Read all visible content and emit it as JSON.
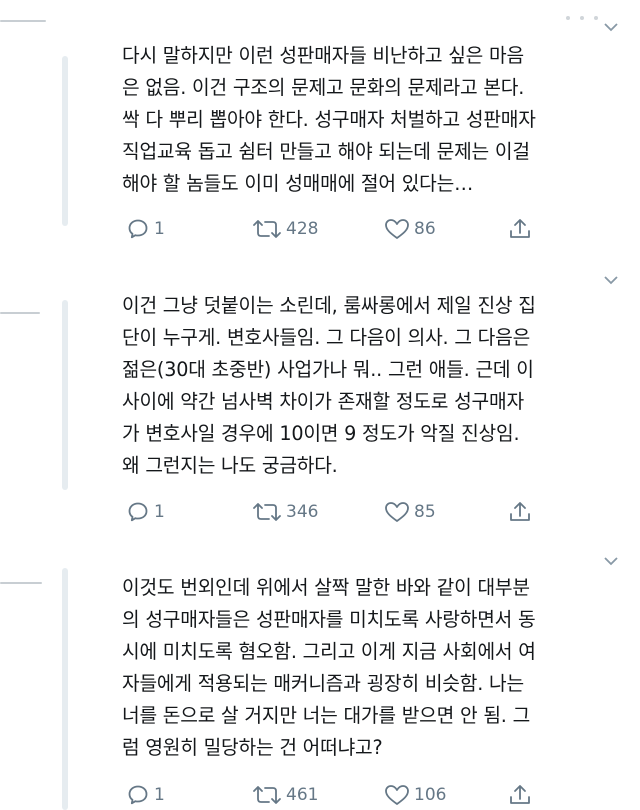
{
  "tweets": [
    {
      "text": "다시 말하지만 이런 성판매자들 비난하고 싶은 마음\n은 없음. 이건 구조의 문제고 문화의 문제라고 본다.\n싹 다 뿌리 뽑아야 한다. 성구매자 처벌하고 성판매자\n직업교육 돕고 쉼터 만들고 해야 되는데 문제는 이걸\n해야 할 놈들도 이미 성매매에 절어 있다는…",
      "replies": "1",
      "retweets": "428",
      "likes": "86"
    },
    {
      "text": "이건 그냥 덧붙이는 소린데, 룸싸롱에서 제일 진상 집\n단이 누구게. 변호사들임. 그 다음이 의사. 그 다음은\n젊은(30대 초중반) 사업가나 뭐.. 그런 애들. 근데 이\n사이에 약간 넘사벽 차이가 존재할 정도로 성구매자\n가 변호사일 경우에 10이면 9 정도가 악질 진상임.\n왜 그런지는 나도 궁금하다.",
      "replies": "1",
      "retweets": "346",
      "likes": "85"
    },
    {
      "text": "이것도 번외인데 위에서 살짝 말한 바와 같이 대부분\n의 성구매자들은 성판매자를 미치도록 사랑하면서 동\n시에 미치도록 혐오함. 그리고 이게 지금 사회에서 여\n자들에게 적용되는 매커니즘과 굉장히 비슷함. 나는\n너를 돈으로 살 거지만 너는 대가를 받으면 안 됨. 그\n럼 영원히 밀당하는 건 어떠냐고?",
      "replies": "1",
      "retweets": "461",
      "likes": "106"
    }
  ],
  "icons": {
    "reply": "reply-icon",
    "retweet": "retweet-icon",
    "like": "heart-icon",
    "share": "share-icon",
    "more": "chevron-down-icon"
  },
  "colors": {
    "text": "#14171a",
    "icon": "#657786",
    "thread_line": "#e6ecf0"
  }
}
